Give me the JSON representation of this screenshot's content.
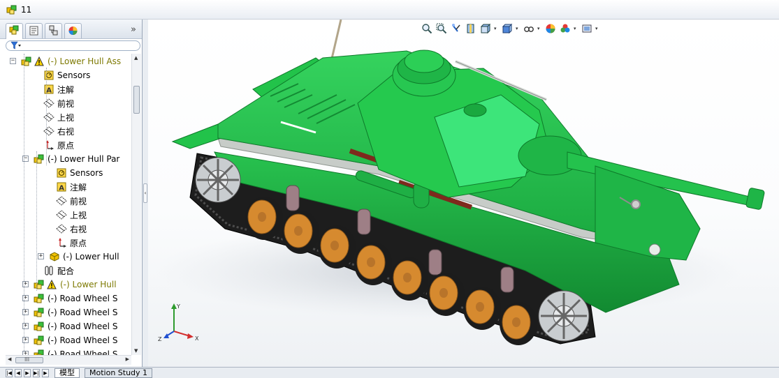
{
  "window": {
    "doc_title": "11"
  },
  "feature_manager": {
    "tabs": [
      "FeatureManager design tree",
      "PropertyManager",
      "ConfigurationManager",
      "DisplayManager"
    ],
    "more": "»",
    "tree": [
      {
        "label": "(-) Lower Hull Ass",
        "icon": "assembly-icon",
        "warn": true,
        "expander": "−"
      },
      {
        "label": "Sensors",
        "icon": "sensors-icon"
      },
      {
        "label": "注解",
        "icon": "annotations-icon"
      },
      {
        "label": "前视",
        "icon": "plane-icon"
      },
      {
        "label": "上视",
        "icon": "plane-icon"
      },
      {
        "label": "右视",
        "icon": "plane-icon"
      },
      {
        "label": "原点",
        "icon": "origin-icon"
      },
      {
        "label": "(-) Lower Hull Par",
        "icon": "assembly-icon",
        "expander": "−"
      },
      {
        "label": "Sensors",
        "icon": "sensors-icon"
      },
      {
        "label": "注解",
        "icon": "annotations-icon"
      },
      {
        "label": "前视",
        "icon": "plane-icon"
      },
      {
        "label": "上视",
        "icon": "plane-icon"
      },
      {
        "label": "右视",
        "icon": "plane-icon"
      },
      {
        "label": "原点",
        "icon": "origin-icon"
      },
      {
        "label": "(-) Lower Hull",
        "icon": "part-icon",
        "expander": "+"
      },
      {
        "label": "配合",
        "icon": "mates-icon"
      },
      {
        "label": "(-) Lower Hull",
        "icon": "assembly-icon",
        "warn": true,
        "expander": "+"
      },
      {
        "label": "(-) Road Wheel S",
        "icon": "assembly-icon",
        "expander": "+"
      },
      {
        "label": "(-) Road Wheel S",
        "icon": "assembly-icon",
        "expander": "+"
      },
      {
        "label": "(-) Road Wheel S",
        "icon": "assembly-icon",
        "expander": "+"
      },
      {
        "label": "(-) Road Wheel S",
        "icon": "assembly-icon",
        "expander": "+"
      },
      {
        "label": "(-) Road Wheel S",
        "icon": "assembly-icon",
        "expander": "+"
      }
    ],
    "hscroll_label": "III"
  },
  "heads_up_toolbar": [
    "zoom-to-fit-icon",
    "zoom-to-area-icon",
    "previous-view-icon",
    "section-view-icon",
    "view-orientation-icon",
    "display-style-icon",
    "hide-show-items-icon",
    "edit-appearance-icon",
    "apply-scene-icon",
    "view-settings-icon"
  ],
  "triad": {
    "x_label": "X",
    "y_label": "Y",
    "z_label": "Z"
  },
  "bottom_tabs": {
    "model": "模型",
    "motion_study": "Motion Study 1"
  },
  "colors": {
    "tank_body": "#22c34a",
    "tank_dark": "#139a36",
    "road_wheel": "#d68a2f",
    "track": "#1c1c1c"
  }
}
